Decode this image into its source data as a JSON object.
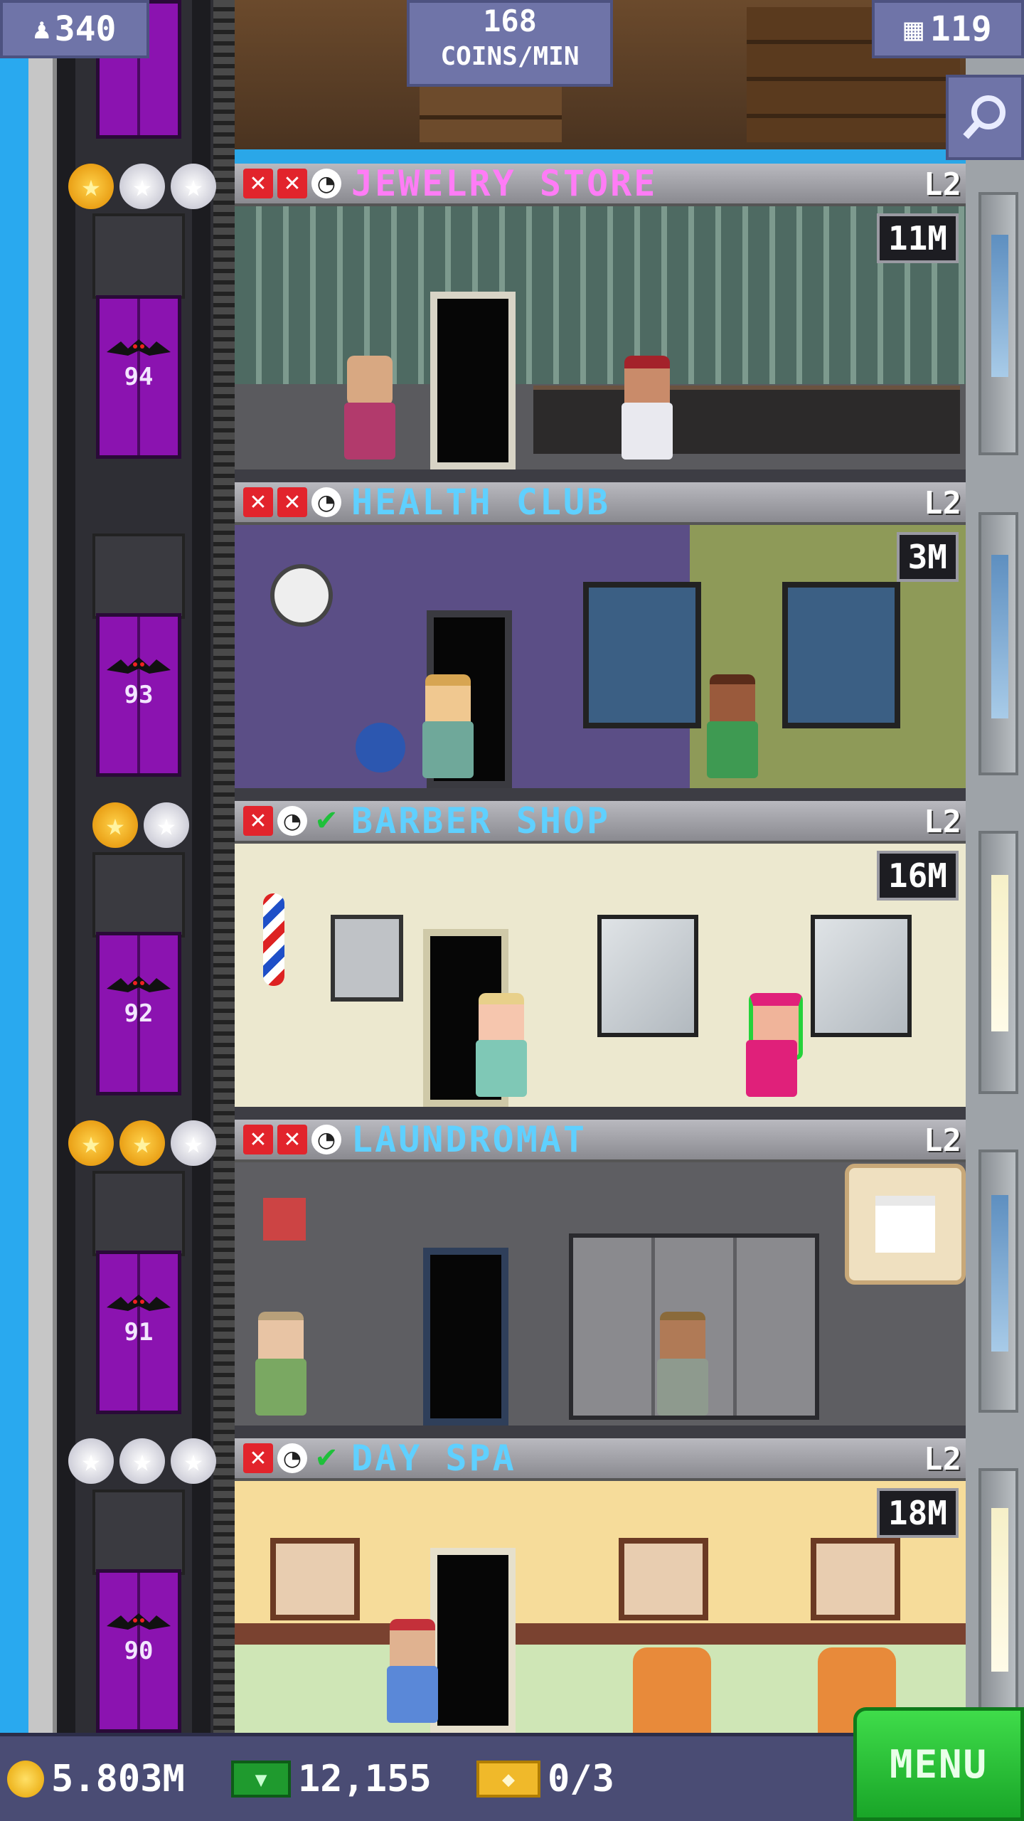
{
  "stats": {
    "population": "340",
    "coins_per_min_value": "168",
    "coins_per_min_label": "COINS/MIN",
    "floors": "119"
  },
  "floors": [
    {
      "name": "JEWELRY STORE",
      "level": "L2",
      "earning": "11M",
      "name_color": "#ff7cf6",
      "stars_filled": 1,
      "stars_total": 3,
      "status_icons": [
        "x-icon",
        "x-icon",
        "clock-icon"
      ],
      "elevator_floor": "94"
    },
    {
      "name": "HEALTH CLUB",
      "level": "L2",
      "earning": "3M",
      "name_color": "#5fd0ff",
      "stars_filled": 0,
      "stars_total": 0,
      "status_icons": [
        "x-icon",
        "x-icon",
        "clock-icon"
      ],
      "elevator_floor": "93"
    },
    {
      "name": "BARBER SHOP",
      "level": "L2",
      "earning": "16M",
      "name_color": "#5fd0ff",
      "stars_filled": 1,
      "stars_total": 2,
      "status_icons": [
        "x-icon",
        "clock-icon",
        "check-icon"
      ],
      "elevator_floor": "92"
    },
    {
      "name": "LAUNDROMAT",
      "level": "L2",
      "earning": "",
      "name_color": "#5fd0ff",
      "stars_filled": 2,
      "stars_total": 3,
      "status_icons": [
        "x-icon",
        "x-icon",
        "clock-icon"
      ],
      "elevator_floor": "91"
    },
    {
      "name": "DAY SPA",
      "level": "L2",
      "earning": "18M",
      "name_color": "#5fd0ff",
      "stars_filled": 0,
      "stars_total": 3,
      "status_icons": [
        "x-icon",
        "clock-icon",
        "check-icon"
      ],
      "elevator_floor": "90"
    }
  ],
  "bottom": {
    "coins": "5.803M",
    "bux": "12,155",
    "tickets": "0/3",
    "menu_label": "MENU"
  },
  "icons": {
    "population": "person-icon",
    "floors": "building-icon",
    "search": "magnifier-icon",
    "coin": "coin-icon",
    "bux": "bux-icon",
    "ticket": "ticket-icon"
  },
  "colors": {
    "elevator": "#8b13b0",
    "hud": "#6f74a8",
    "menu": "#1fbf2c"
  }
}
